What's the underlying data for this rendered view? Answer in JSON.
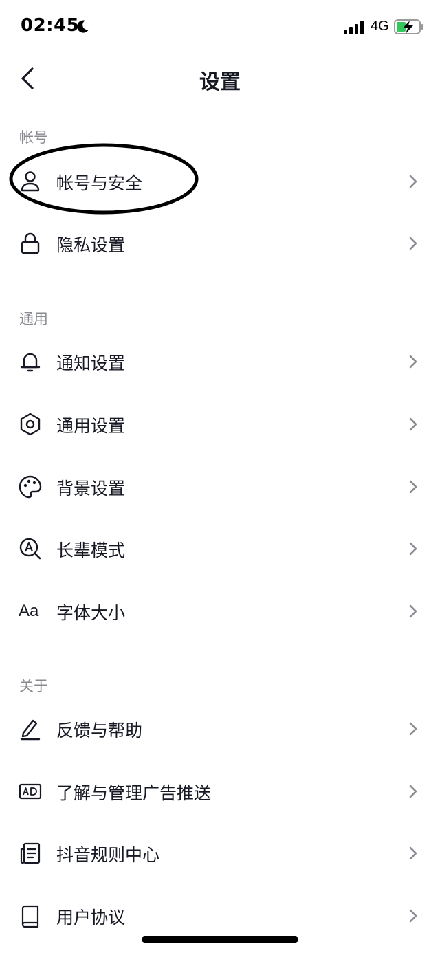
{
  "status_bar": {
    "time": "02:45",
    "network": "4G"
  },
  "header": {
    "title": "设置"
  },
  "sections": [
    {
      "title": "帐号",
      "items": [
        {
          "label": "帐号与安全",
          "icon": "person-icon"
        },
        {
          "label": "隐私设置",
          "icon": "lock-icon"
        }
      ]
    },
    {
      "title": "通用",
      "items": [
        {
          "label": "通知设置",
          "icon": "bell-icon"
        },
        {
          "label": "通用设置",
          "icon": "gear-icon"
        },
        {
          "label": "背景设置",
          "icon": "palette-icon"
        },
        {
          "label": "长辈模式",
          "icon": "elder-mode-icon"
        },
        {
          "label": "字体大小",
          "icon": "font-size-icon",
          "icon_text": "Aa"
        }
      ]
    },
    {
      "title": "关于",
      "items": [
        {
          "label": "反馈与帮助",
          "icon": "edit-icon"
        },
        {
          "label": "了解与管理广告推送",
          "icon": "ad-icon"
        },
        {
          "label": "抖音规则中心",
          "icon": "document-icon"
        },
        {
          "label": "用户协议",
          "icon": "book-icon"
        }
      ]
    }
  ],
  "colors": {
    "text": "#161823",
    "secondary_text": "#8a8b91",
    "divider": "#e4e4e6",
    "battery_charge": "#34c759"
  }
}
